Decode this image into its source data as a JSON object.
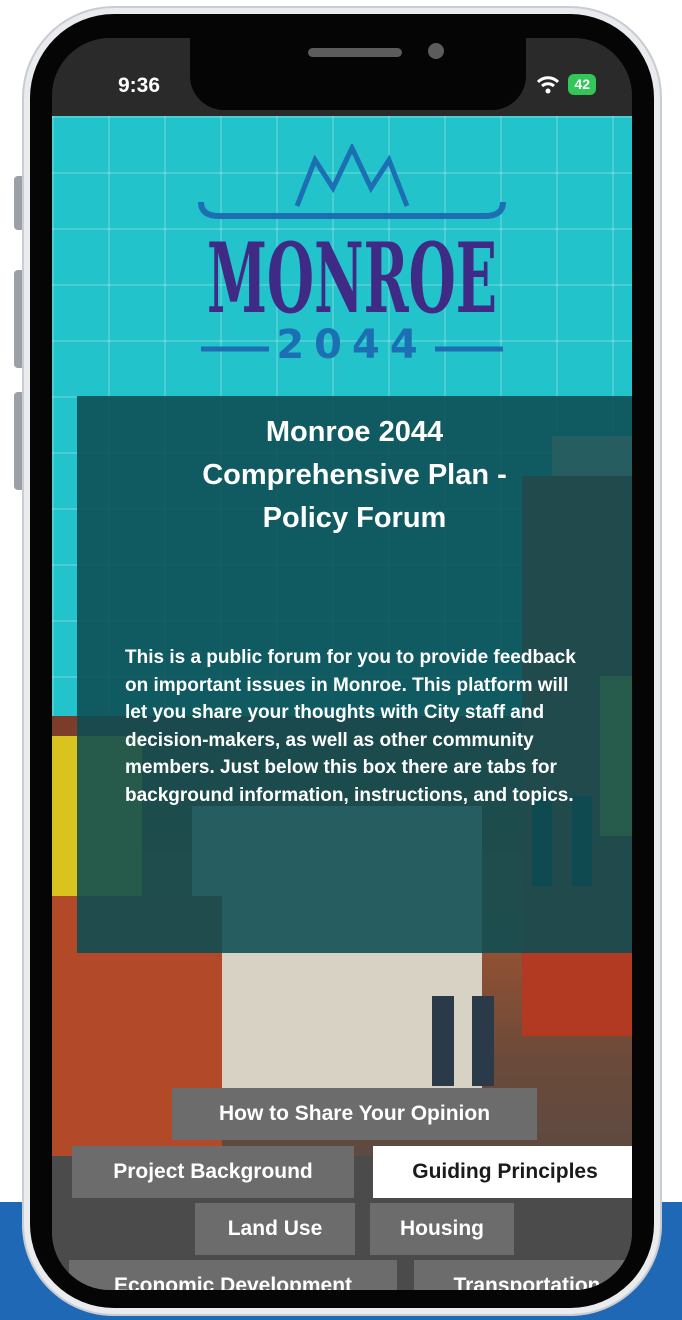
{
  "status_bar": {
    "time": "9:36",
    "battery": "42"
  },
  "logo": {
    "word": "MONROE",
    "year": "2044"
  },
  "intro": {
    "title_lines": [
      "Monroe 2044",
      "Comprehensive Plan -",
      "Policy Forum"
    ],
    "body": "This is a public forum for you to provide feedback on important issues in Monroe. This platform will let you share your thoughts with City staff and decision-makers, as well as other community members. Just below this box there are tabs for background information, instructions, and topics."
  },
  "tabs": {
    "how_to_share": "How to Share Your Opinion",
    "project_background": "Project Background",
    "guiding_principles": "Guiding Principles",
    "land_use": "Land Use",
    "housing": "Housing",
    "economic_development": "Economic Development",
    "transportation": "Transportation",
    "active": "Guiding Principles"
  },
  "colors": {
    "teal": "#22c3cb",
    "box": "#0d4c52",
    "logo_purple": "#3f2a86",
    "logo_blue": "#1d6fb3",
    "tab_gray": "#6c6c6c",
    "page_blue": "#1f68b5"
  }
}
